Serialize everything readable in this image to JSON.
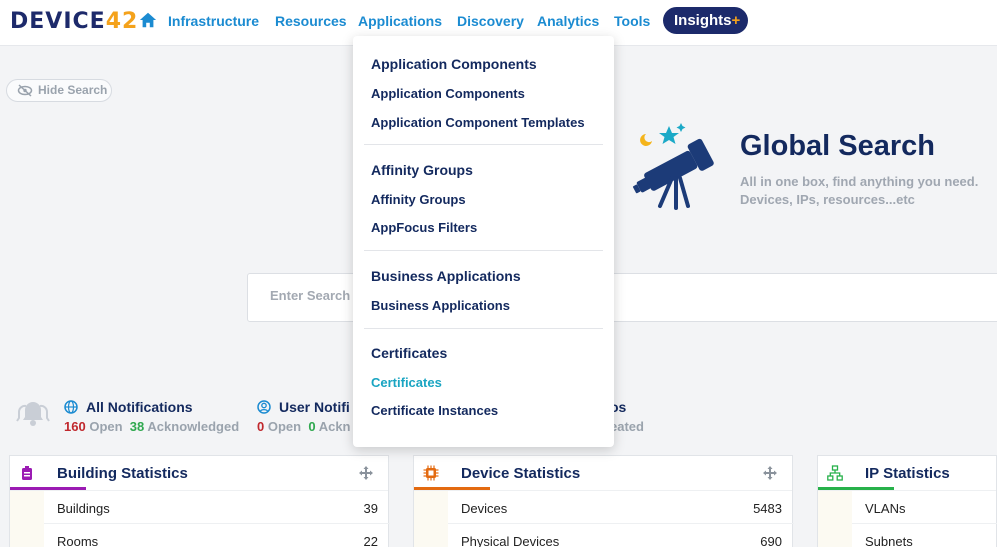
{
  "brand": {
    "logo_part1": "DEVICE",
    "logo_part2": "42"
  },
  "nav": {
    "items": [
      "Infrastructure",
      "Resources",
      "Applications",
      "Discovery",
      "Analytics",
      "Tools"
    ],
    "insights_label": "Insights",
    "insights_plus": "+"
  },
  "search": {
    "hide_label": "Hide Search",
    "title": "Global Search",
    "subtitle": "All in one box, find anything you need. Devices, IPs, resources...etc",
    "placeholder": "Enter Search"
  },
  "notifications": {
    "all": {
      "title": "All Notifications",
      "open_count": "160",
      "open_label": "Open",
      "ack_count": "38",
      "ack_label": "Acknowledged"
    },
    "user": {
      "title": "User Notifi",
      "open_count": "0",
      "open_label": "Open",
      "ack_count": "0",
      "ack_label": "Ackn"
    },
    "third": {
      "title_tail": "os",
      "sub_tail": "eated"
    }
  },
  "dropdown": {
    "sections": [
      {
        "header": "Application Components",
        "items": [
          "Application Components",
          "Application Component Templates"
        ]
      },
      {
        "header": "Affinity Groups",
        "items": [
          "Affinity Groups",
          "AppFocus Filters"
        ]
      },
      {
        "header": "Business Applications",
        "items": [
          "Business Applications"
        ]
      },
      {
        "header": "Certificates",
        "items": [
          "Certificates",
          "Certificate Instances"
        ]
      }
    ]
  },
  "cards": {
    "building": {
      "title": "Building Statistics",
      "rows": [
        {
          "label": "Buildings",
          "value": "39"
        },
        {
          "label": "Rooms",
          "value": "22"
        }
      ]
    },
    "device": {
      "title": "Device Statistics",
      "rows": [
        {
          "label": "Devices",
          "value": "5483"
        },
        {
          "label": "Physical Devices",
          "value": "690"
        }
      ]
    },
    "ip": {
      "title": "IP Statistics",
      "rows": [
        {
          "label": "VLANs",
          "value": ""
        },
        {
          "label": "Subnets",
          "value": ""
        }
      ]
    }
  },
  "colors": {
    "nav_link": "#1b8bd1",
    "navy": "#13295e",
    "accent_orange": "#f4a21b",
    "active_teal": "#1aa5c2",
    "building_accent": "#9b1bb3",
    "device_accent": "#e36a10",
    "ip_accent": "#27b14a"
  },
  "icons": [
    "home-icon",
    "eye-off-icon",
    "telescope-icon",
    "bell-icon",
    "globe-icon",
    "user-circle-icon",
    "building-icon",
    "chip-icon",
    "network-icon",
    "move-icon"
  ]
}
